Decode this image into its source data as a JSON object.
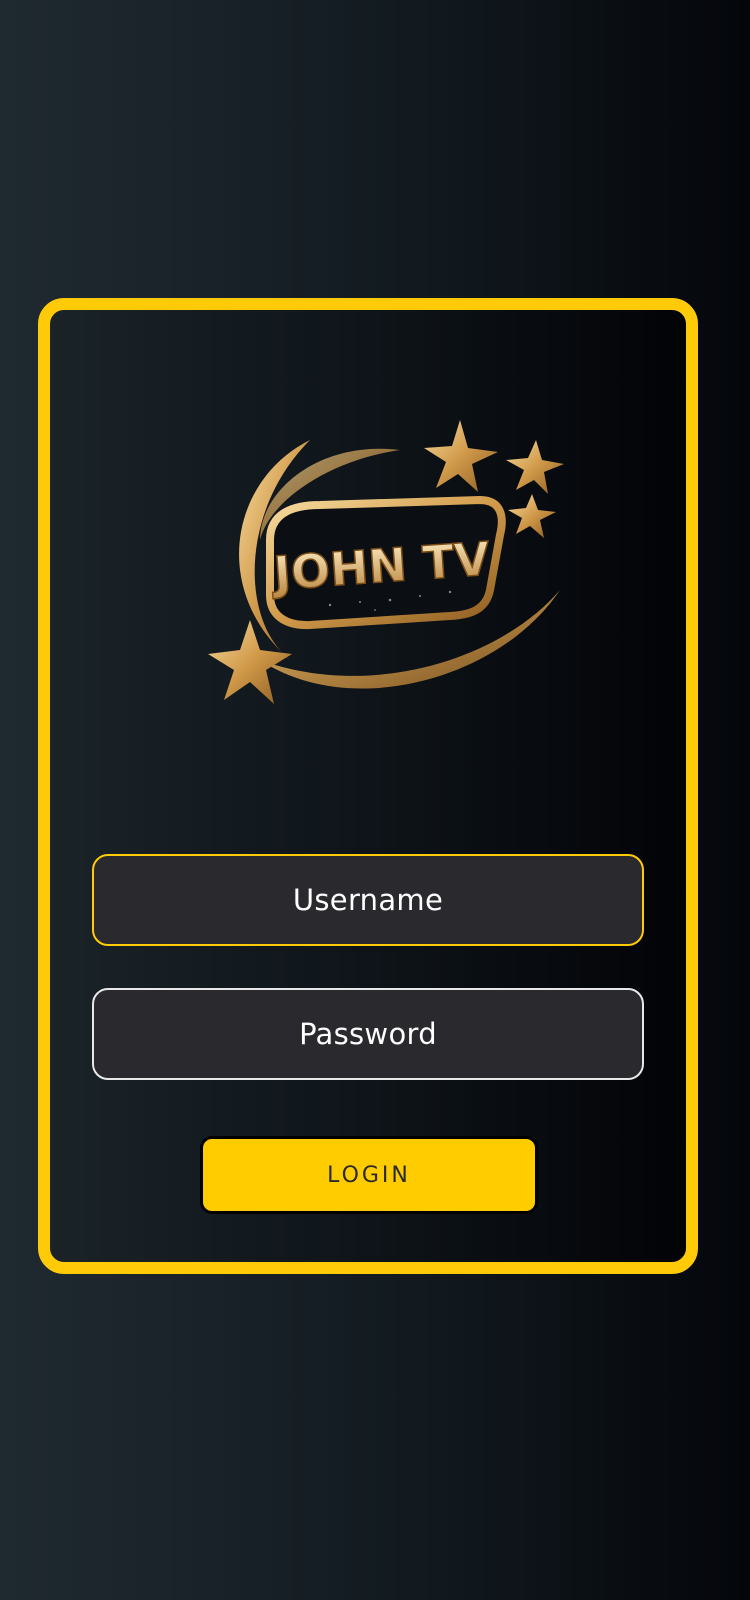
{
  "colors": {
    "accent": "#ffca08",
    "field_bg": "#2a2a2e",
    "button_bg": "#ffcc00"
  },
  "logo": {
    "text": "JOHN TV",
    "icon": "john-tv-logo"
  },
  "form": {
    "username_placeholder": "Username",
    "password_placeholder": "Password",
    "login_label": "LOGIN"
  }
}
